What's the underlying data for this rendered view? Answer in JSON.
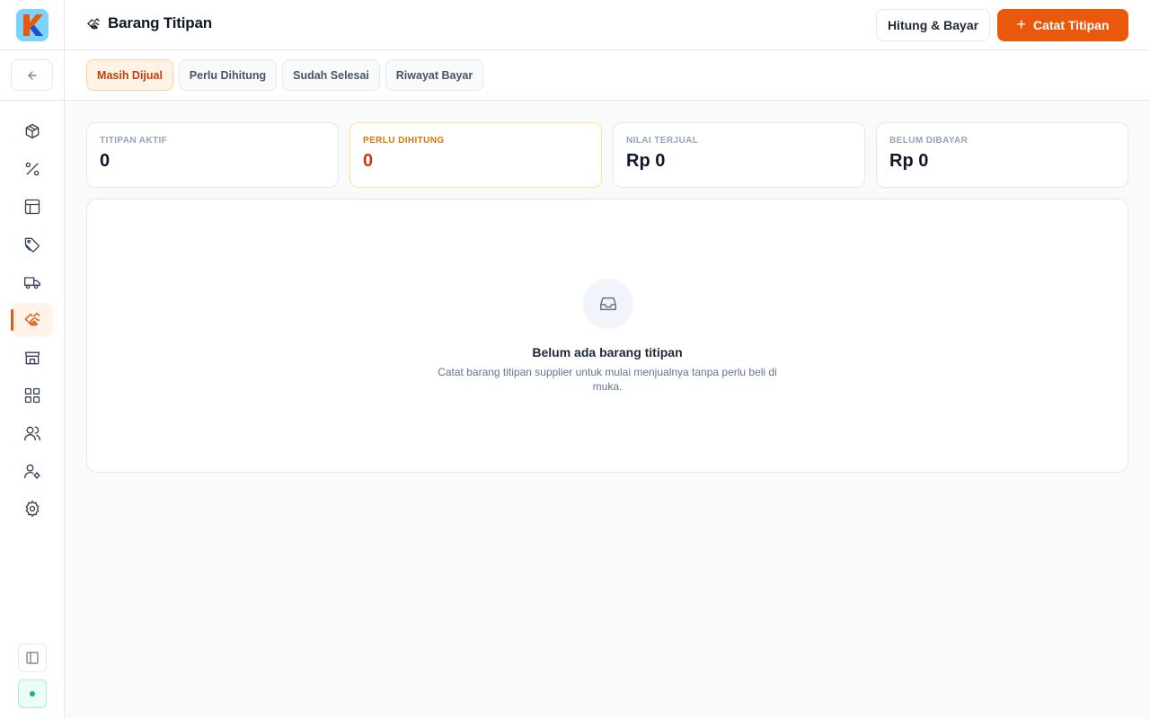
{
  "header": {
    "title": "Barang Titipan",
    "secondary_button": "Hitung & Bayar",
    "primary_button": "Catat Titipan",
    "primary_button_icon": "+"
  },
  "tabs": [
    {
      "label": "Masih Dijual",
      "active": true
    },
    {
      "label": "Perlu Dihitung",
      "active": false
    },
    {
      "label": "Sudah Selesai",
      "active": false
    },
    {
      "label": "Riwayat Bayar",
      "active": false
    }
  ],
  "stats": [
    {
      "label": "TITIPAN AKTIF",
      "value": "0"
    },
    {
      "label": "PERLU DIHITUNG",
      "value": "0"
    },
    {
      "label": "NILAI TERJUAL",
      "value": "Rp 0"
    },
    {
      "label": "BELUM DIBAYAR",
      "value": "Rp 0"
    }
  ],
  "empty_state": {
    "title": "Belum ada barang titipan",
    "description": "Catat barang titipan supplier untuk mulai menjualnya tanpa perlu beli di muka."
  },
  "sidebar": {
    "items": [
      {
        "icon": "box-icon"
      },
      {
        "icon": "percent-icon"
      },
      {
        "icon": "layout-icon"
      },
      {
        "icon": "tag-icon"
      },
      {
        "icon": "truck-icon"
      },
      {
        "icon": "handshake-icon",
        "active": true
      },
      {
        "icon": "store-icon"
      },
      {
        "icon": "grid-icon"
      },
      {
        "icon": "users-icon"
      },
      {
        "icon": "user-cog-icon"
      },
      {
        "icon": "settings-icon"
      }
    ]
  },
  "colors": {
    "accent": "#ea580c",
    "accent_soft": "#fff3e6",
    "status_online": "#10b981"
  }
}
